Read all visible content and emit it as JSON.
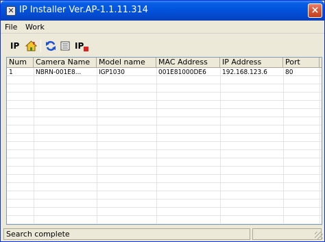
{
  "window": {
    "title": "IP Installer Ver.AP-1.1.11.314",
    "close_glyph": "×"
  },
  "menu": {
    "items": [
      "File",
      "Work"
    ]
  },
  "toolbar": {
    "ip_label": "IP",
    "ip_r_label": "IP"
  },
  "table": {
    "columns": [
      "Num",
      "Camera Name",
      "Model name",
      "MAC Address",
      "IP Address",
      "Port",
      ""
    ],
    "rows": [
      [
        "1",
        "NBRN-001E8...",
        "IGP1030",
        "001E81000DE6",
        "192.168.123.6",
        "80",
        ""
      ]
    ]
  },
  "status": {
    "text": "Search complete"
  },
  "colors": {
    "titlebar": "#0254dc",
    "close": "#d85b3a",
    "window_bg": "#ece9d8"
  }
}
